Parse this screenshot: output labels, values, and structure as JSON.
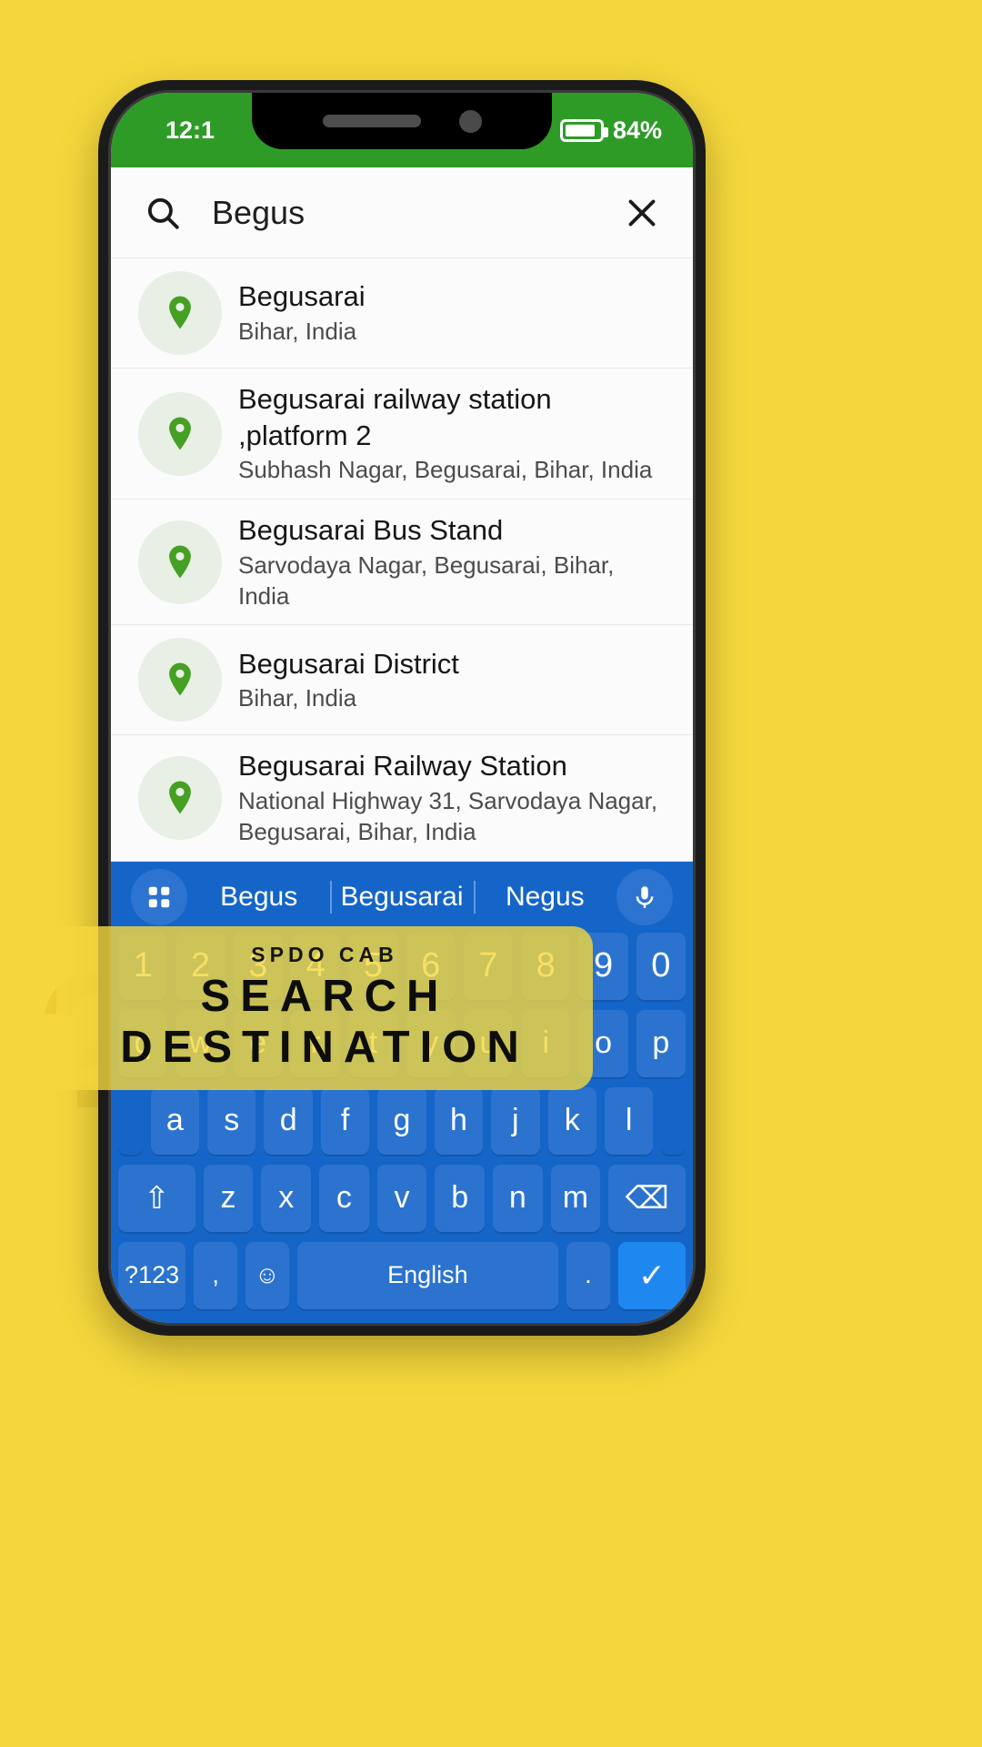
{
  "statusbar": {
    "time": "12:1",
    "battery_percent": "84%",
    "battery_icon": "battery-icon"
  },
  "search": {
    "icon": "search-icon",
    "value": "Begus",
    "placeholder": "Search destination",
    "clear_icon": "close-icon"
  },
  "results": [
    {
      "icon": "location-pin-icon",
      "title": "Begusarai",
      "subtitle": "Bihar, India"
    },
    {
      "icon": "location-pin-icon",
      "title": "Begusarai railway station ,platform 2",
      "subtitle": "Subhash Nagar, Begusarai, Bihar, India"
    },
    {
      "icon": "location-pin-icon",
      "title": "Begusarai Bus Stand",
      "subtitle": "Sarvodaya Nagar, Begusarai, Bihar, India"
    },
    {
      "icon": "location-pin-icon",
      "title": "Begusarai District",
      "subtitle": "Bihar, India"
    },
    {
      "icon": "location-pin-icon",
      "title": "Begusarai Railway Station",
      "subtitle": "National Highway 31, Sarvodaya Nagar, Begusarai, Bihar, India"
    }
  ],
  "keyboard": {
    "left_icon": "keyboard-switcher-icon",
    "right_icon": "microphone-icon",
    "suggestions": [
      "Begus",
      "Begusarai",
      "Negus"
    ],
    "row_numbers": [
      "1",
      "2",
      "3",
      "4",
      "5",
      "6",
      "7",
      "8",
      "9",
      "0"
    ],
    "row_top": [
      "q",
      "w",
      "e",
      "r",
      "t",
      "y",
      "u",
      "i",
      "o",
      "p"
    ],
    "row_home": [
      "a",
      "s",
      "d",
      "f",
      "g",
      "h",
      "j",
      "k",
      "l"
    ],
    "row_bottom": [
      "z",
      "x",
      "c",
      "v",
      "b",
      "n",
      "m"
    ],
    "shift_label": "⇧",
    "backspace_label": "⌫",
    "symbols_label": "?123",
    "comma_label": ",",
    "emoji_label": "☺",
    "space_label": "English",
    "period_label": ".",
    "enter_label": "✓"
  },
  "navbar": {
    "recents": "≡",
    "home": "□",
    "back": "▽"
  },
  "banner": {
    "kicker": "SPDO CAB",
    "line1": "SEARCH",
    "line2": "DESTINATION"
  },
  "background": {
    "glyph": "?"
  },
  "colors": {
    "page_bg": "#F5D73C",
    "status_green": "#2E9B27",
    "keyboard_blue": "#1565C8",
    "key_blue": "#2B73CE",
    "accent_enter": "#1E88F0",
    "pin_green": "#46A023"
  }
}
